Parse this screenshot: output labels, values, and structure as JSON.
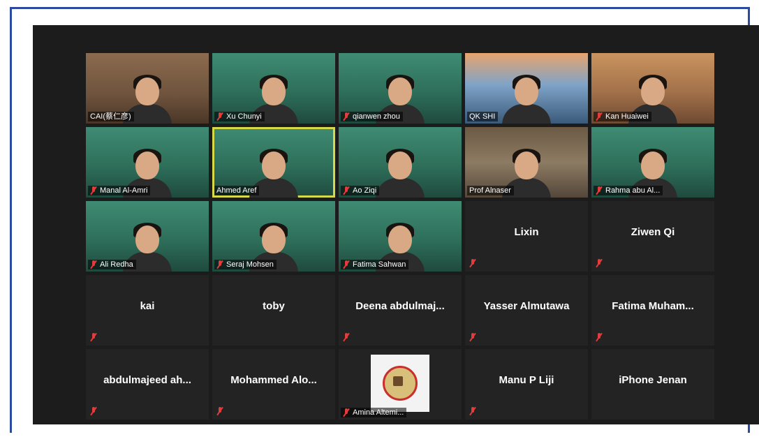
{
  "participants": [
    {
      "name": "CAI(蔡仁彦)",
      "type": "video",
      "scene": "room",
      "muted": false
    },
    {
      "name": "Xu Chunyi",
      "type": "video",
      "scene": "poster",
      "muted": true
    },
    {
      "name": "qianwen zhou",
      "type": "video",
      "scene": "poster",
      "muted": true
    },
    {
      "name": "QK SHI",
      "type": "video",
      "scene": "bridge",
      "muted": false
    },
    {
      "name": "Kan Huaiwei",
      "type": "video",
      "scene": "home",
      "muted": true
    },
    {
      "name": "Manal Al-Amri",
      "type": "video",
      "scene": "poster",
      "muted": true
    },
    {
      "name": "Ahmed Aref",
      "type": "video",
      "scene": "poster",
      "muted": false,
      "speaking": true
    },
    {
      "name": "Ao Ziqi",
      "type": "video",
      "scene": "poster",
      "muted": true
    },
    {
      "name": "Prof Alnaser",
      "type": "video",
      "scene": "office",
      "muted": false
    },
    {
      "name": "Rahma abu Al...",
      "type": "video",
      "scene": "poster",
      "muted": true
    },
    {
      "name": "Ali Redha",
      "type": "video",
      "scene": "poster",
      "muted": true
    },
    {
      "name": "Seraj Mohsen",
      "type": "video",
      "scene": "poster",
      "muted": true
    },
    {
      "name": "Fatima Sahwan",
      "type": "video",
      "scene": "poster",
      "muted": true
    },
    {
      "name": "Lixin",
      "type": "name",
      "muted": true
    },
    {
      "name": "Ziwen Qi",
      "type": "name",
      "muted": true
    },
    {
      "name": "kai",
      "type": "name",
      "muted": true
    },
    {
      "name": "toby",
      "type": "name",
      "muted": false
    },
    {
      "name": "Deena abdulmaj...",
      "type": "name",
      "muted": true
    },
    {
      "name": "Yasser Almutawa",
      "type": "name",
      "muted": true
    },
    {
      "name": "Fatima Muham...",
      "type": "name",
      "muted": true
    },
    {
      "name": "abdulmajeed ah...",
      "type": "name",
      "muted": true
    },
    {
      "name": "Mohammed Alo...",
      "type": "name",
      "muted": true
    },
    {
      "name": "Amina Altemi...",
      "type": "logo",
      "muted": true
    },
    {
      "name": "Manu P Liji",
      "type": "name",
      "muted": true
    },
    {
      "name": "iPhone Jenan",
      "type": "name",
      "muted": false
    }
  ],
  "colors": {
    "speaking_border": "#d6d94a",
    "muted_icon": "#e23c3c",
    "background": "#1c1c1c"
  }
}
